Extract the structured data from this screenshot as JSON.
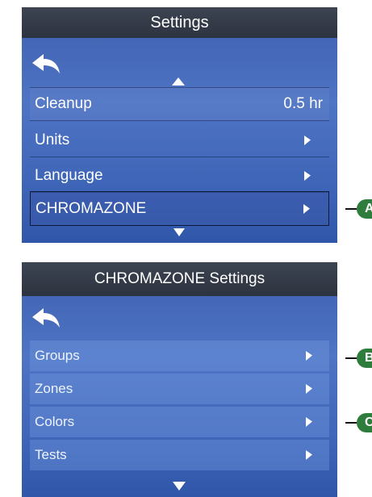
{
  "screen_top": {
    "title": "Settings",
    "rows": [
      {
        "label": "Cleanup",
        "value": "0.5 hr"
      },
      {
        "label": "Units"
      },
      {
        "label": "Language"
      },
      {
        "label": "CHROMAZONE"
      }
    ]
  },
  "screen_bottom": {
    "title": "CHROMAZONE Settings",
    "rows": [
      {
        "label": "Groups"
      },
      {
        "label": "Zones"
      },
      {
        "label": "Colors"
      },
      {
        "label": "Tests"
      }
    ]
  },
  "callouts": [
    "A",
    "B",
    "C"
  ],
  "colors": {
    "titlebar": "#2d333f",
    "screen_bg": "#4a6ec0",
    "callout_badge": "#2e7d3c"
  },
  "icons": [
    "back-arrow-icon",
    "scroll-up-icon",
    "scroll-down-icon",
    "chevron-right-icon"
  ]
}
